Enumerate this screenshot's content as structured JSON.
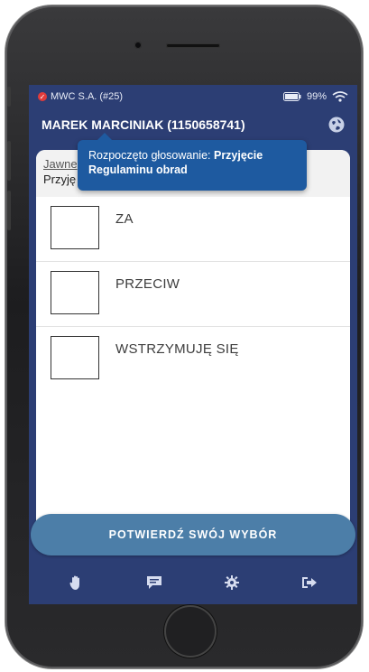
{
  "status_bar": {
    "org": "MWC S.A. (#25)",
    "battery": "99%"
  },
  "header": {
    "user": "MAREK MARCINIAK (1150658741)"
  },
  "vote": {
    "type_label": "Jawne",
    "title_partial": "Przyję"
  },
  "toast": {
    "prefix": "Rozpoczęto głosowanie: ",
    "emphasis_1": "Przyjęcie",
    "emphasis_2": "Regulaminu obrad"
  },
  "options": [
    {
      "label": "ZA"
    },
    {
      "label": "PRZECIW"
    },
    {
      "label": "WSTRZYMUJĘ SIĘ"
    }
  ],
  "confirm": {
    "label": "POTWIERDŹ SWÓJ WYBÓR"
  },
  "nav": [
    {
      "icon": "hand-icon"
    },
    {
      "icon": "chat-icon"
    },
    {
      "icon": "gear-icon"
    },
    {
      "icon": "logout-icon"
    }
  ],
  "colors": {
    "header_bg": "#2c3e74",
    "toast_bg": "#1e5aa0",
    "button_bg": "#4c7ea8",
    "badge_red": "#e03b3b"
  }
}
